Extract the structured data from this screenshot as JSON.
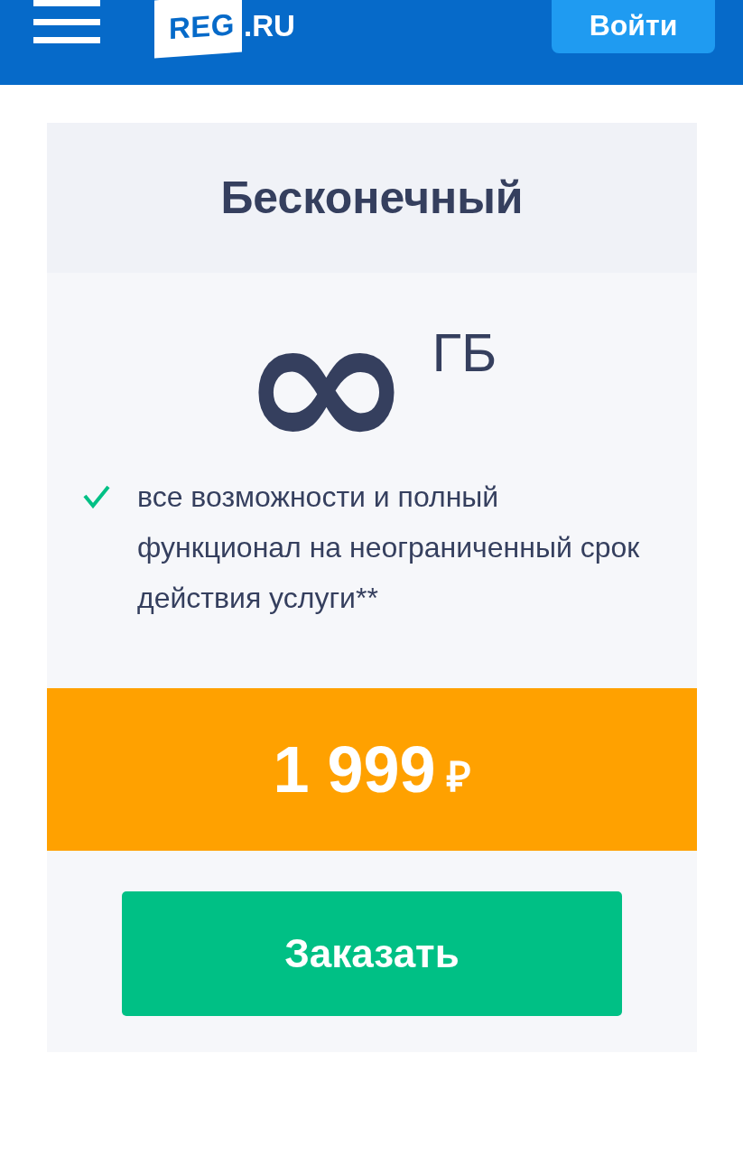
{
  "header": {
    "logo": {
      "mark": "REG",
      "suffix": ".RU"
    },
    "login_button": "Войти"
  },
  "plan": {
    "title": "Бесконечный",
    "volume": "∞",
    "unit": "ГБ",
    "features": [
      {
        "text": "все возможности и полный функционал на неограниченный срок действия услуги**",
        "checked": true
      }
    ],
    "price": "1 999",
    "currency": "₽",
    "order_button": "Заказать"
  }
}
